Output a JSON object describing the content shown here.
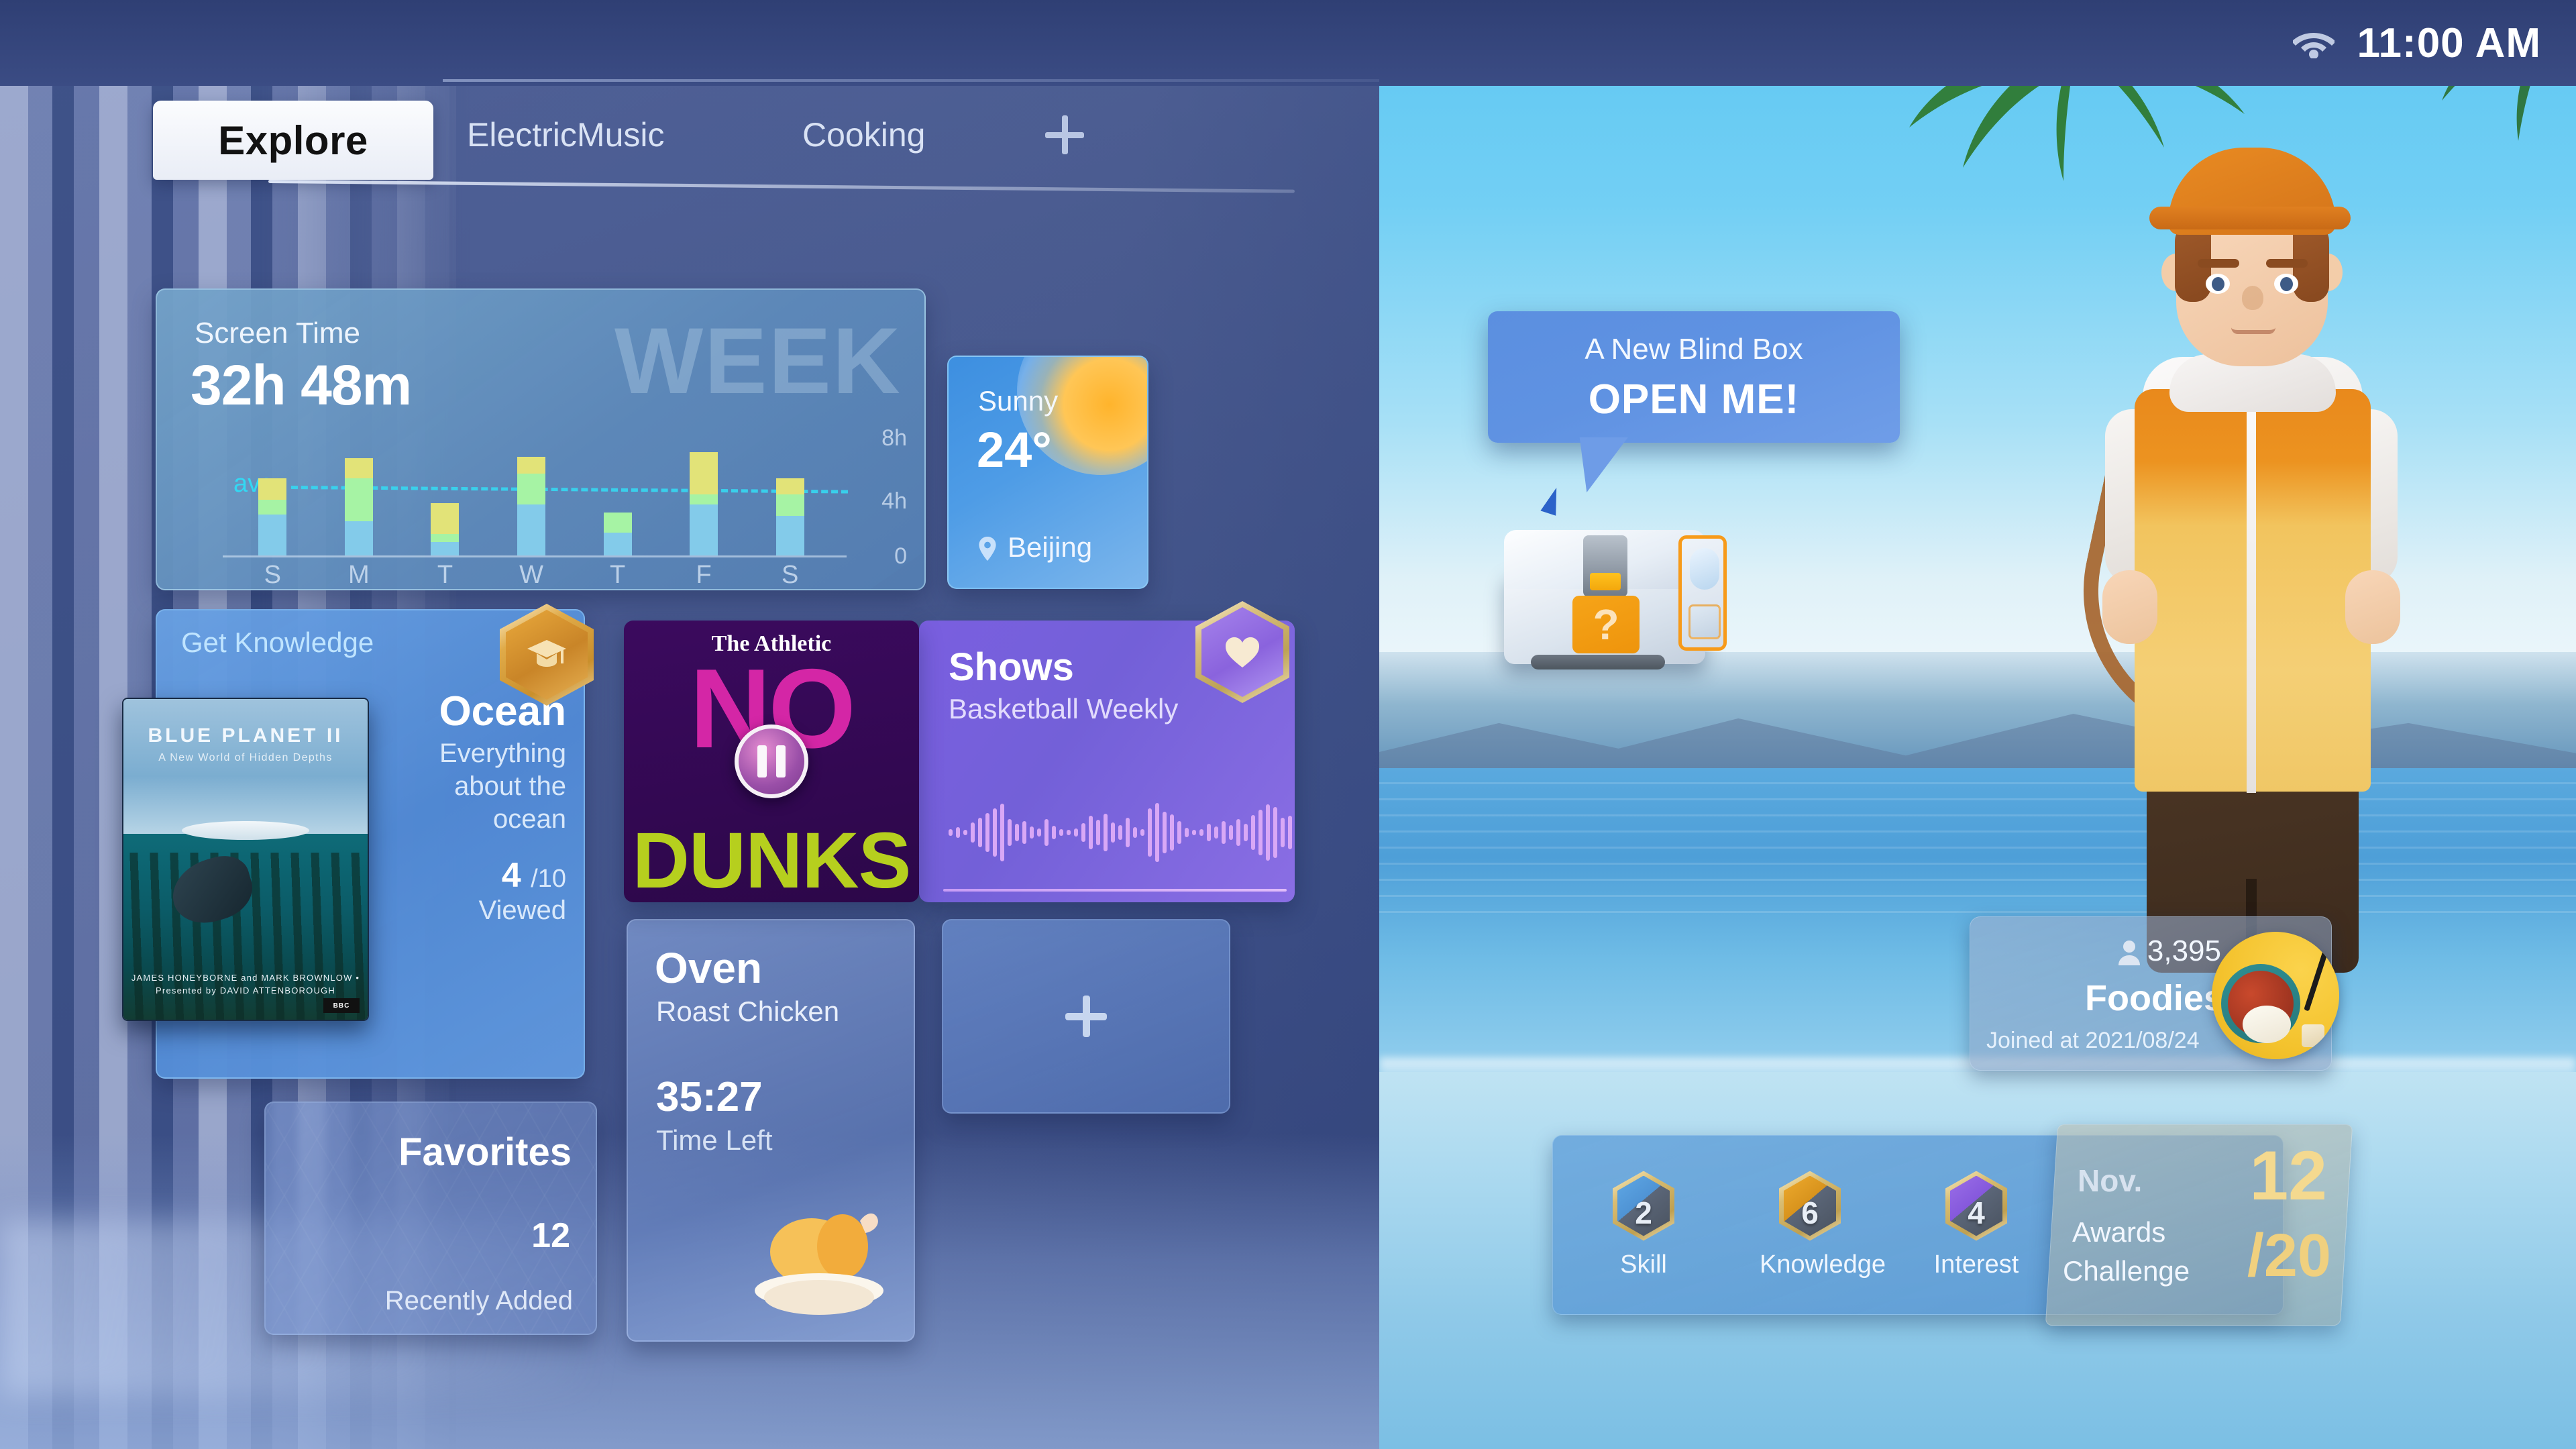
{
  "status_bar": {
    "wifi_icon": "wifi-icon",
    "time": "11:00 AM"
  },
  "tabs": {
    "active": "Explore",
    "items": [
      "Explore",
      "ElectricMusic",
      "Cooking"
    ],
    "add_label": "+"
  },
  "screen_time": {
    "title": "Screen Time",
    "value": "32h 48m",
    "period_watermark": "WEEK",
    "avg_label": "avg",
    "y_ticks": [
      "8h",
      "4h",
      "0"
    ],
    "x_ticks": [
      "S",
      "M",
      "T",
      "W",
      "T",
      "F",
      "S"
    ]
  },
  "chart_data": {
    "type": "bar",
    "title": "Screen Time",
    "subtitle": "32h 48m",
    "xlabel": "",
    "ylabel": "hours",
    "ylim": [
      0,
      8
    ],
    "grid": false,
    "legend": "none",
    "categories": [
      "S",
      "M",
      "T",
      "W",
      "T",
      "F",
      "S"
    ],
    "stacked": true,
    "series": [
      {
        "name": "base-blue",
        "color": "#83cbea",
        "values": [
          2.5,
          2.1,
          0.8,
          3.1,
          1.4,
          3.1,
          2.4
        ]
      },
      {
        "name": "mid-green",
        "color": "#a6f3a4",
        "values": [
          0.9,
          2.6,
          0.5,
          1.9,
          1.2,
          0.6,
          1.3
        ]
      },
      {
        "name": "top-yellow",
        "color": "#e2e378",
        "values": [
          1.3,
          1.2,
          1.9,
          1.0,
          0.0,
          2.6,
          1.0
        ]
      }
    ],
    "totals": [
      4.7,
      5.9,
      3.2,
      6.0,
      2.6,
      6.3,
      4.7
    ],
    "average_line": {
      "label": "avg",
      "value": 4.7,
      "color": "#33d8f3",
      "style": "dashed"
    }
  },
  "weather": {
    "condition": "Sunny",
    "temperature": "24°",
    "location": "Beijing",
    "pin_icon": "location-pin-icon",
    "sun_icon": "sun-icon"
  },
  "knowledge": {
    "title": "Get Knowledge",
    "badge_icon": "graduation-cap-badge-icon",
    "item_name": "Ocean",
    "item_desc": "Everything about the ocean",
    "progress_current": "4",
    "progress_total": "/10",
    "progress_label": "Viewed",
    "poster": {
      "title": "BLUE PLANET II",
      "subtitle": "A New World of Hidden Depths",
      "credits": "JAMES HONEYBORNE and MARK BROWNLOW  •  Presented by DAVID ATTENBOROUGH",
      "network": "BBC"
    }
  },
  "favorites": {
    "title": "Favorites",
    "count": "12",
    "subtitle": "Recently  Added"
  },
  "podcast": {
    "network": "The Athletic",
    "title_line1": "NO",
    "title_line2": "DUNKS",
    "play_state_icon": "pause-icon"
  },
  "shows": {
    "title": "Shows",
    "subtitle": "Basketball Weekly",
    "badge_icon": "heart-badge-icon",
    "waveform_icon": "audio-waveform-icon"
  },
  "oven": {
    "title": "Oven",
    "subtitle": "Roast Chicken",
    "time": "35:27",
    "time_label": "Time Left",
    "food_icon": "roast-chicken-icon"
  },
  "add_card": {
    "label": "+",
    "icon": "plus-icon"
  },
  "bubble": {
    "line1": "A New Blind Box",
    "line2": "OPEN ME!"
  },
  "blind_box": {
    "icon": "mystery-chest-icon",
    "mark": "?"
  },
  "avatar": {
    "icon": "avatar-character-icon"
  },
  "foodies": {
    "member_icon": "person-icon",
    "member_count": "3,395",
    "name": "Foodies",
    "joined": "Joined at 2021/08/24",
    "thumb_icon": "food-bowl-icon"
  },
  "achievements": {
    "items": [
      {
        "label": "Skill",
        "value": "2",
        "icon": "skill-badge-icon",
        "color": "#5fa8e6"
      },
      {
        "label": "Knowledge",
        "value": "6",
        "icon": "knowledge-badge-icon",
        "color": "#eeab2e"
      },
      {
        "label": "Interest",
        "value": "4",
        "icon": "interest-badge-icon",
        "color": "#9b6fe8"
      }
    ],
    "awards": {
      "month": "Nov.",
      "line1": "Awards",
      "line2": "Challenge",
      "current": "12",
      "total": "/20"
    }
  }
}
